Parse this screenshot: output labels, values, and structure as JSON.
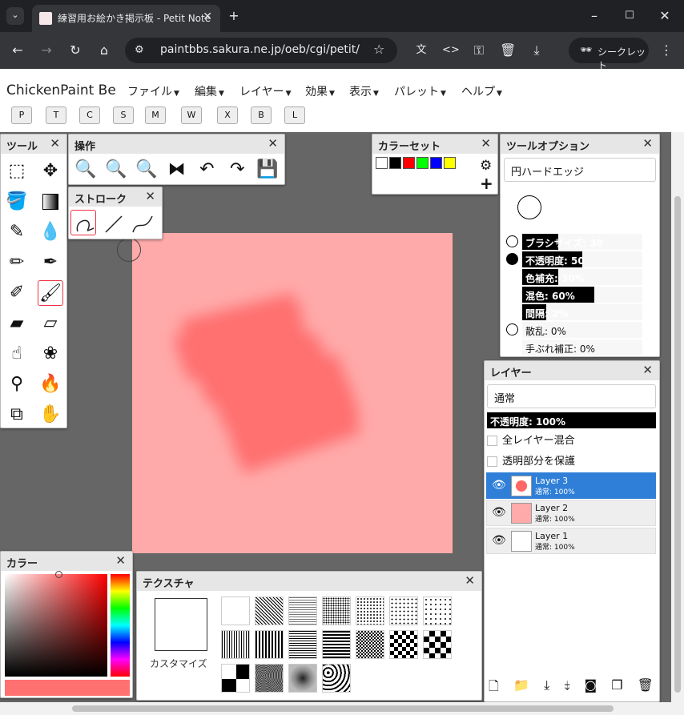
{
  "browser": {
    "tab_title": "練習用お絵かき掲示板 - Petit Note",
    "url": "paintbbs.sakura.ne.jp/oeb/cgi/petit/",
    "incognito_label": "シークレット"
  },
  "app": {
    "title": "ChickenPaint Be",
    "menus": [
      "ファイル",
      "編集",
      "レイヤー",
      "効果",
      "表示",
      "パレット",
      "ヘルプ"
    ],
    "hotkeys": [
      "P",
      "T",
      "C",
      "S",
      "M",
      "W",
      "X",
      "B",
      "L"
    ]
  },
  "panels": {
    "tools": "ツール",
    "ops": "操作",
    "stroke": "ストローク",
    "colorset": "カラーセット",
    "tooloptions": "ツールオプション",
    "layers": "レイヤー",
    "color": "カラー",
    "texture": "テクスチャ"
  },
  "tooloptions": {
    "brush_name": "円ハードエッジ",
    "sliders": [
      {
        "label": "ブラシサイズ",
        "value": "30",
        "fill": 0.3
      },
      {
        "label": "不透明度",
        "value": "50",
        "fill": 0.5
      },
      {
        "label": "色補充",
        "value": "30%",
        "fill": 0.3
      },
      {
        "label": "混色",
        "value": "60%",
        "fill": 0.6
      },
      {
        "label": "間隔",
        "value": "2%",
        "fill": 0.02
      },
      {
        "label": "散乱",
        "value": "0%",
        "fill": 0
      },
      {
        "label": "手ぶれ補正",
        "value": "0%",
        "fill": 0
      }
    ]
  },
  "colorset": {
    "swatches": [
      "#ffffff",
      "#000000",
      "#ff0000",
      "#00ff00",
      "#0000ff",
      "#ffff00"
    ]
  },
  "layers": {
    "blend_mode": "通常",
    "opacity_label": "不透明度: 100%",
    "opacity": 1.0,
    "merge_all_label": "全レイヤー混合",
    "protect_label": "透明部分を保護",
    "items": [
      {
        "name": "Layer 3",
        "info": "通常: 100%",
        "selected": true
      },
      {
        "name": "Layer 2",
        "info": "通常: 100%",
        "selected": false
      },
      {
        "name": "Layer 1",
        "info": "通常: 100%",
        "selected": false
      }
    ]
  },
  "texture": {
    "customize_label": "カスタマイズ"
  },
  "colors": {
    "canvas": "#ffaaaa",
    "stroke": "#ff6666",
    "current": "#ff7070"
  }
}
